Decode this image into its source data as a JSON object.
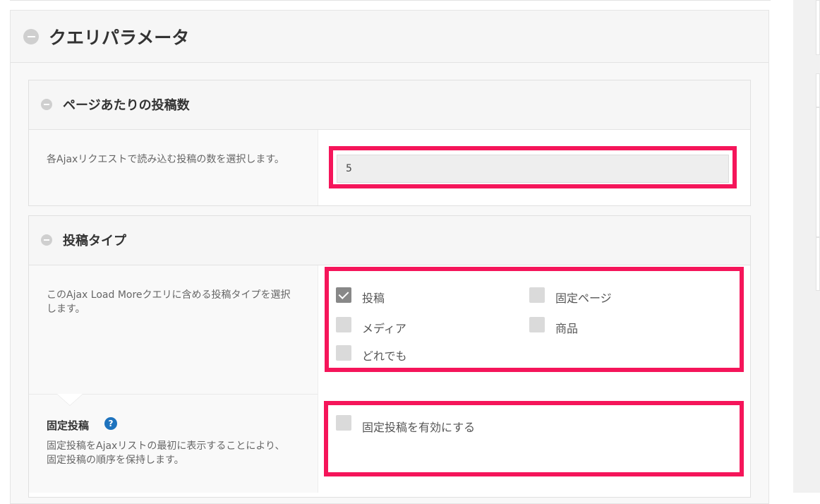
{
  "query_params": {
    "title": "クエリパラメータ"
  },
  "posts_per_page": {
    "title": "ページあたりの投稿数",
    "description": "各Ajaxリクエストで読み込む投稿の数を選択します。",
    "value": "5"
  },
  "post_type": {
    "title": "投稿タイプ",
    "description": "このAjax Load Moreクエリに含める投稿タイプを選択します。",
    "options": [
      {
        "label": "投稿",
        "checked": true
      },
      {
        "label": "固定ページ",
        "checked": false
      },
      {
        "label": "メディア",
        "checked": false
      },
      {
        "label": "商品",
        "checked": false
      },
      {
        "label": "どれでも",
        "checked": false
      }
    ]
  },
  "sticky_posts": {
    "title": "固定投稿",
    "help_icon": "?",
    "description": "固定投稿をAjaxリストの最初に表示することにより、固定投稿の順序を保持します。",
    "checkbox_label": "固定投稿を有効にする",
    "checked": false
  },
  "colors": {
    "highlight": "#f5155a",
    "help_icon": "#1e73be"
  }
}
